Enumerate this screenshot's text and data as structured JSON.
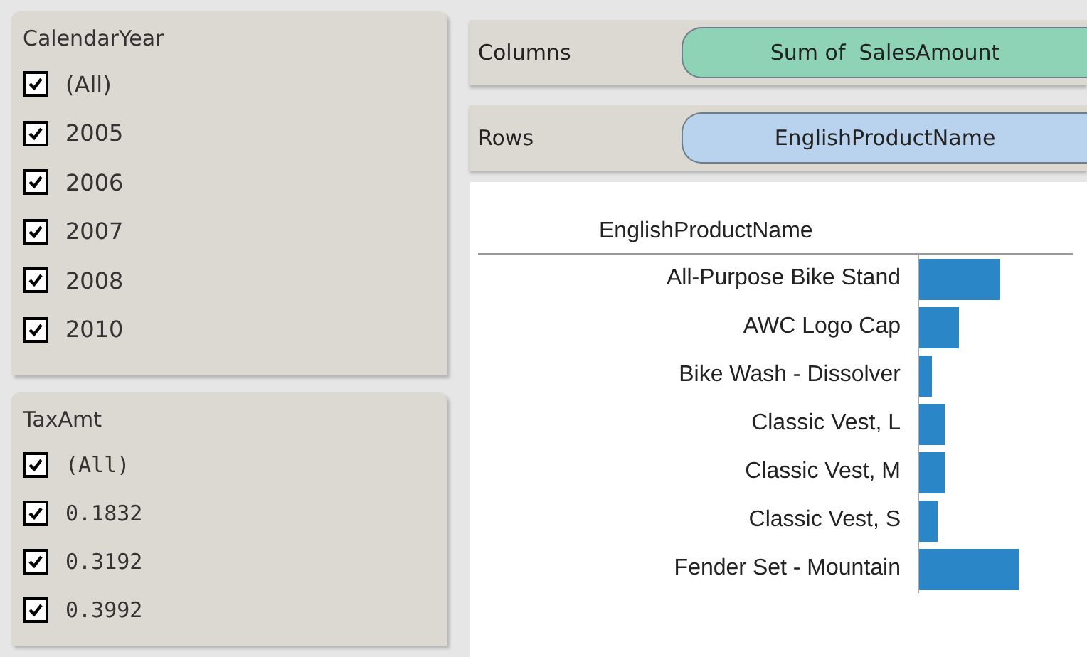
{
  "filters": [
    {
      "title": "CalendarYear",
      "items": [
        {
          "label": "(All)",
          "checked": true
        },
        {
          "label": "2005",
          "checked": true
        },
        {
          "label": "2006",
          "checked": true
        },
        {
          "label": "2007",
          "checked": true
        },
        {
          "label": "2008",
          "checked": true
        },
        {
          "label": "2010",
          "checked": true
        }
      ]
    },
    {
      "title": "TaxAmt",
      "items": [
        {
          "label": "(All)",
          "checked": true
        },
        {
          "label": "0.1832",
          "checked": true
        },
        {
          "label": "0.3192",
          "checked": true
        },
        {
          "label": "0.3992",
          "checked": true
        }
      ]
    }
  ],
  "shelves": [
    {
      "label": "Columns",
      "pill": "Sum of  SalesAmount",
      "color": "#8fd3b6"
    },
    {
      "label": "Rows",
      "pill": "EnglishProductName",
      "color": "#b9d3ee"
    }
  ],
  "view": {
    "header": "EnglishProductName",
    "rows": [
      "All-Purpose Bike Stand",
      "AWC Logo Cap",
      "Bike Wash - Dissolver",
      "Classic Vest, L",
      "Classic Vest, M",
      "Classic Vest, S",
      "Fender Set - Mountain"
    ]
  }
}
